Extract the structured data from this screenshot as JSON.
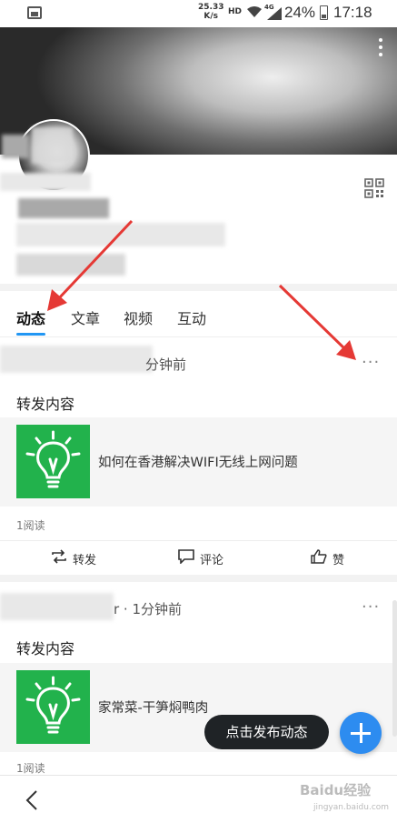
{
  "status_bar": {
    "speed_value": "25.33",
    "speed_unit": "K/s",
    "hd": "HD",
    "network": "4G",
    "battery": "24%",
    "time": "17:18"
  },
  "tabs": [
    {
      "label": "动态"
    },
    {
      "label": "文章"
    },
    {
      "label": "视频"
    },
    {
      "label": "互动"
    }
  ],
  "posts": [
    {
      "time": "分钟前",
      "repost_label": "转发内容",
      "card_title": "如何在香港解决WIFI无线上网问题",
      "reads": "1阅读",
      "actions": {
        "share": "转发",
        "comment": "评论",
        "like": "赞"
      }
    },
    {
      "time": "r · 1分钟前",
      "repost_label": "转发内容",
      "card_title": "家常菜-干笋焖鸭肉",
      "reads": "1阅读"
    }
  ],
  "more_dots": "···",
  "tooltip": "点击发布动态",
  "watermark": "Baidu经验",
  "watermark_sub": "jingyan.baidu.com",
  "colors": {
    "accent": "#2196f3",
    "fab": "#2d8cf0",
    "thumb_green": "#22b24c",
    "arrow_red": "#e53935"
  }
}
